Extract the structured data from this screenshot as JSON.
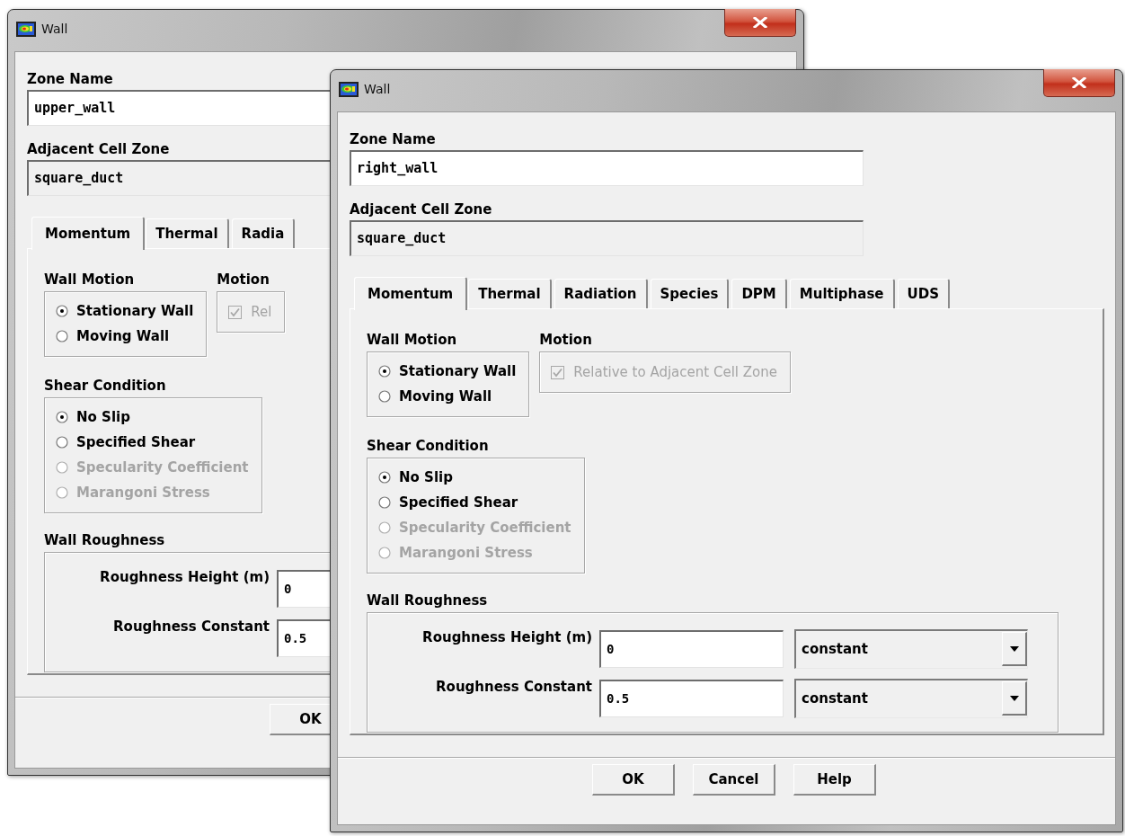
{
  "windows": [
    {
      "title": "Wall",
      "zone_name": {
        "label": "Zone Name",
        "value": "upper_wall"
      },
      "adjacent_cell_zone": {
        "label": "Adjacent Cell Zone",
        "value": "square_duct"
      },
      "tabs": [
        {
          "label": "Momentum",
          "selected": true
        },
        {
          "label": "Thermal",
          "selected": false
        },
        {
          "label": "Radia",
          "selected": false
        }
      ],
      "wall_motion": {
        "label": "Wall Motion",
        "options": [
          {
            "label": "Stationary Wall",
            "selected": true,
            "disabled": false
          },
          {
            "label": "Moving Wall",
            "selected": false,
            "disabled": false
          }
        ]
      },
      "motion": {
        "label": "Motion",
        "checkbox": {
          "label": "Rel",
          "checked": true,
          "disabled": true
        }
      },
      "shear_condition": {
        "label": "Shear Condition",
        "options": [
          {
            "label": "No Slip",
            "selected": true,
            "disabled": false
          },
          {
            "label": "Specified Shear",
            "selected": false,
            "disabled": false
          },
          {
            "label": "Specularity Coefficient",
            "selected": false,
            "disabled": true
          },
          {
            "label": "Marangoni Stress",
            "selected": false,
            "disabled": true
          }
        ]
      },
      "wall_roughness": {
        "label": "Wall Roughness",
        "rows": [
          {
            "label": "Roughness Height (m)",
            "value": "0"
          },
          {
            "label": "Roughness Constant",
            "value": "0.5"
          }
        ]
      },
      "buttons": [
        "OK"
      ]
    },
    {
      "title": "Wall",
      "zone_name": {
        "label": "Zone Name",
        "value": "right_wall"
      },
      "adjacent_cell_zone": {
        "label": "Adjacent Cell Zone",
        "value": "square_duct"
      },
      "tabs": [
        {
          "label": "Momentum",
          "selected": true
        },
        {
          "label": "Thermal",
          "selected": false
        },
        {
          "label": "Radiation",
          "selected": false
        },
        {
          "label": "Species",
          "selected": false
        },
        {
          "label": "DPM",
          "selected": false
        },
        {
          "label": "Multiphase",
          "selected": false
        },
        {
          "label": "UDS",
          "selected": false
        }
      ],
      "wall_motion": {
        "label": "Wall Motion",
        "options": [
          {
            "label": "Stationary Wall",
            "selected": true,
            "disabled": false
          },
          {
            "label": "Moving Wall",
            "selected": false,
            "disabled": false
          }
        ]
      },
      "motion": {
        "label": "Motion",
        "checkbox": {
          "label": "Relative to Adjacent Cell Zone",
          "checked": true,
          "disabled": true
        }
      },
      "shear_condition": {
        "label": "Shear Condition",
        "options": [
          {
            "label": "No Slip",
            "selected": true,
            "disabled": false
          },
          {
            "label": "Specified Shear",
            "selected": false,
            "disabled": false
          },
          {
            "label": "Specularity Coefficient",
            "selected": false,
            "disabled": true
          },
          {
            "label": "Marangoni Stress",
            "selected": false,
            "disabled": true
          }
        ]
      },
      "wall_roughness": {
        "label": "Wall Roughness",
        "rows": [
          {
            "label": "Roughness Height (m)",
            "value": "0",
            "method": "constant"
          },
          {
            "label": "Roughness Constant",
            "value": "0.5",
            "method": "constant"
          }
        ]
      },
      "buttons": [
        "OK",
        "Cancel",
        "Help"
      ]
    }
  ]
}
